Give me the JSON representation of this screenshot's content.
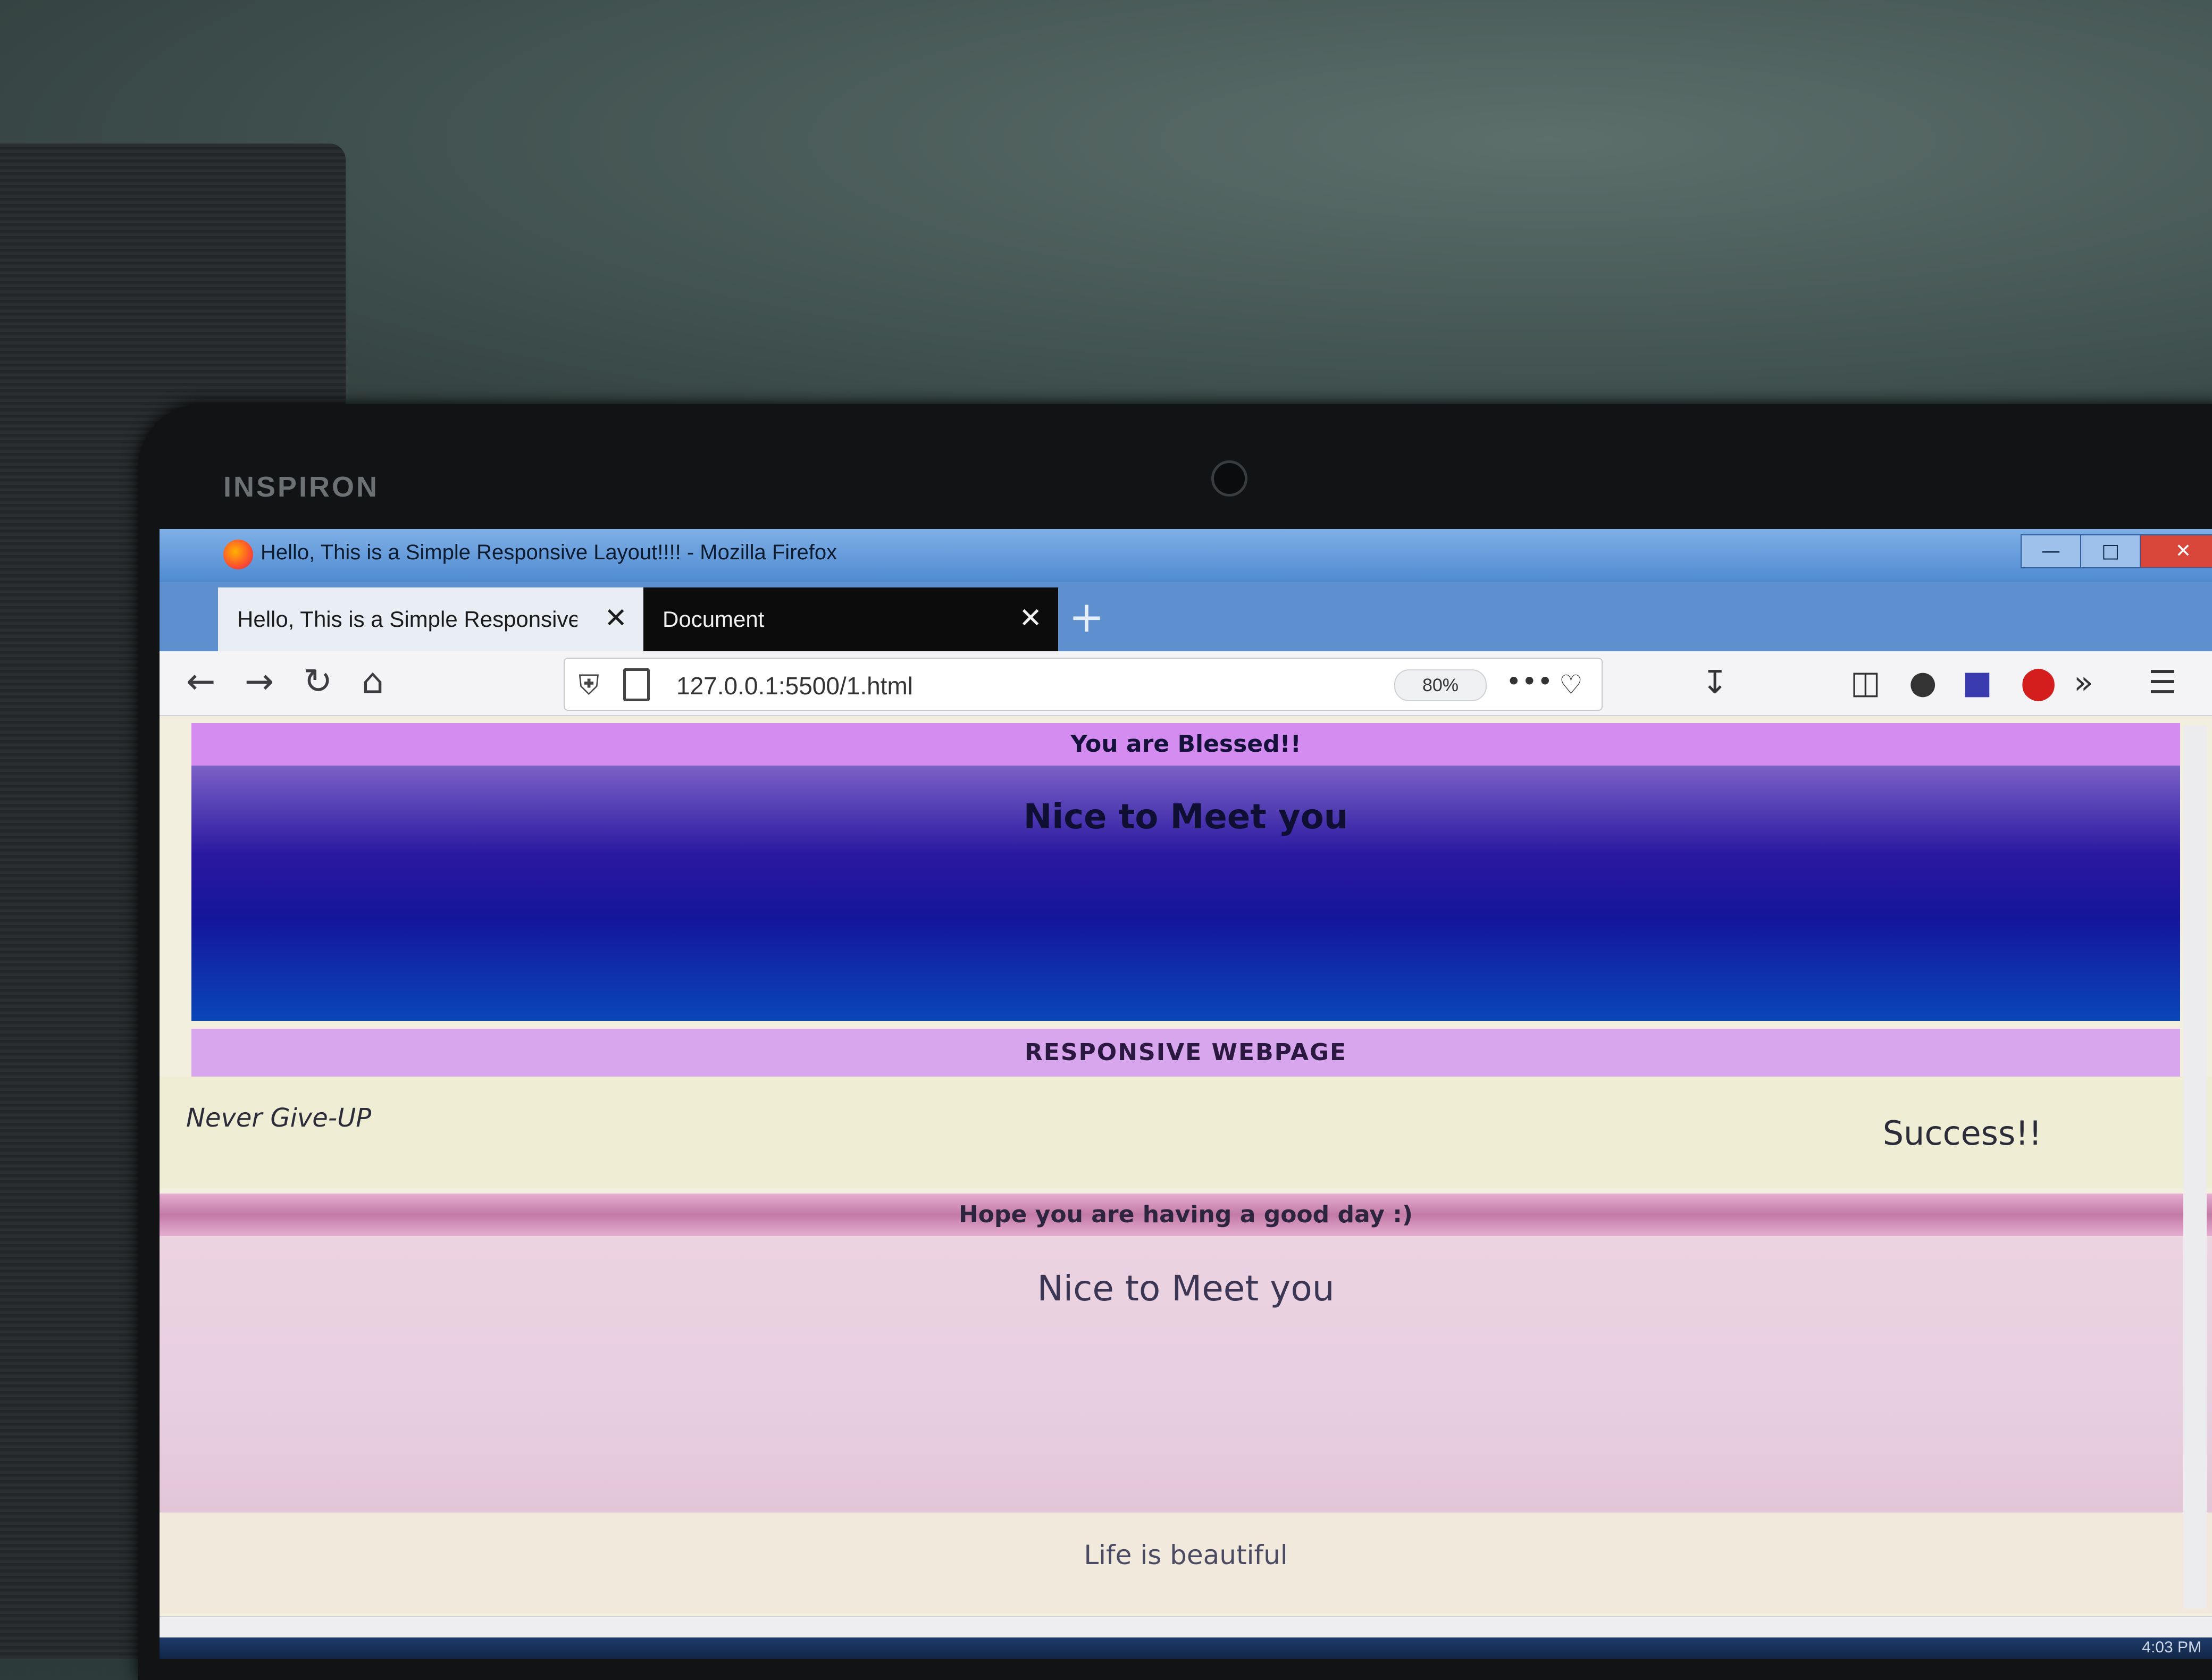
{
  "device": {
    "brand": "INSPIRON"
  },
  "window": {
    "title": "Hello, This is a Simple Responsive Layout!!!! - Mozilla Firefox"
  },
  "tabs": [
    {
      "label": "Hello, This is a Simple Responsive L"
    },
    {
      "label": "Document"
    }
  ],
  "navbar": {
    "url": "127.0.0.1:5500/1.html",
    "zoom": "80%"
  },
  "page": {
    "top_banner": "You are Blessed!!",
    "hero_text": "Nice to Meet you",
    "mid_banner": "RESPONSIVE WEBPAGE",
    "left_text": "Never Give-UP",
    "right_text": "Success!!",
    "pink_banner": "Hope you are having a good day :)",
    "pink_text": "Nice to Meet you",
    "footer_text": "Life is beautiful"
  },
  "taskbar": {
    "clock": "4:03 PM"
  },
  "colors": {
    "top_banner": "#d58cf0",
    "hero_dark": "#14169a",
    "mid_banner": "#d7a6ec",
    "pink_band": "#c27aa6",
    "pink_section": "#ecd3e0"
  }
}
